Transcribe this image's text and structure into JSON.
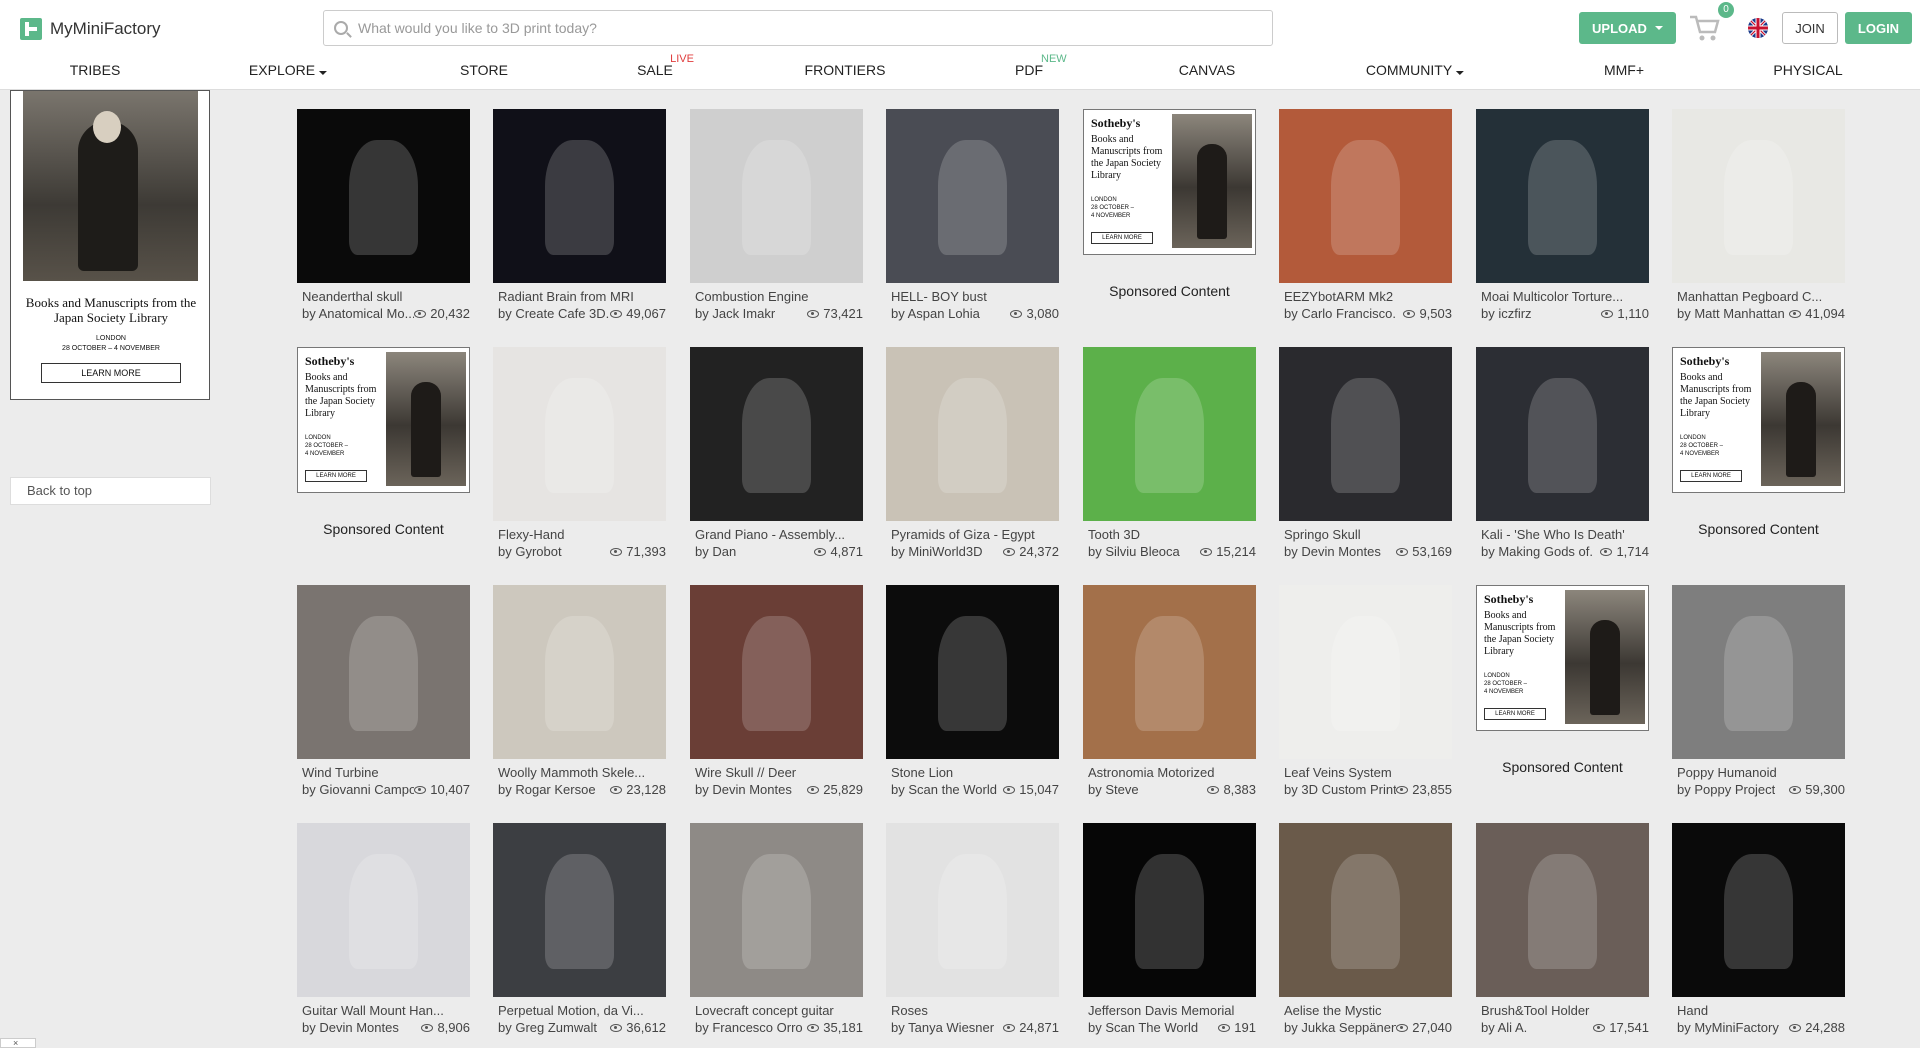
{
  "header": {
    "logo_text": "MyMiniFactory",
    "search_placeholder": "What would you like to 3D print today?",
    "upload_label": "UPLOAD",
    "cart_count": "0",
    "join_label": "JOIN",
    "login_label": "LOGIN"
  },
  "nav": {
    "items": [
      {
        "label": "TRIBES"
      },
      {
        "label": "EXPLORE"
      },
      {
        "label": "STORE"
      },
      {
        "label": "SALE",
        "badge": "LIVE"
      },
      {
        "label": "FRONTIERS"
      },
      {
        "label": "PDF",
        "badge": "NEW"
      },
      {
        "label": "CANVAS"
      },
      {
        "label": "COMMUNITY"
      },
      {
        "label": "MMF+"
      },
      {
        "label": "PHYSICAL"
      }
    ]
  },
  "sidebar": {
    "ad_title": "Books and Manuscripts from the Japan Society Library",
    "ad_sub": "LONDON\n28 OCTOBER – 4 NOVEMBER",
    "ad_button": "LEARN MORE",
    "back_to_top": "Back to top"
  },
  "sponsor": {
    "brand": "Sotheby's",
    "text": "Books and Manuscripts from the Japan Society Library",
    "small": "LONDON\n28 OCTOBER –\n4 NOVEMBER",
    "button": "LEARN MORE",
    "label": "Sponsored Content"
  },
  "rows": [
    [
      {
        "title": "Neanderthal skull",
        "author": "by Anatomical Mo...",
        "views": "20,432",
        "color": "#0a0a0a"
      },
      {
        "title": "Radiant Brain from MRI",
        "author": "by Create Cafe 3D...",
        "views": "49,067",
        "color": "#101018"
      },
      {
        "title": "Combustion Engine",
        "author": "by Jack Imakr",
        "views": "73,421",
        "color": "#cfcfcf"
      },
      {
        "title": "HELL- BOY bust",
        "author": "by Aspan Lohia",
        "views": "3,080",
        "color": "#4a4c54"
      },
      {
        "sponsored": true
      },
      {
        "title": "EEZYbotARM Mk2",
        "author": "by Carlo Francisco...",
        "views": "9,503",
        "color": "#b35a3a"
      },
      {
        "title": "Moai Multicolor Torture...",
        "author": "by iczfirz",
        "views": "1,110",
        "color": "#243038"
      },
      {
        "title": "Manhattan Pegboard C...",
        "author": "by Matt Manhattan",
        "views": "41,094",
        "color": "#e8e8e4"
      }
    ],
    [
      {
        "sponsored": true
      },
      {
        "title": "Flexy-Hand",
        "author": "by Gyrobot",
        "views": "71,393",
        "color": "#e6e4e2"
      },
      {
        "title": "Grand Piano - Assembly...",
        "author": "by Dan",
        "views": "4,871",
        "color": "#222222"
      },
      {
        "title": "Pyramids of Giza - Egypt",
        "author": "by MiniWorld3D",
        "views": "24,372",
        "color": "#c9c2b6"
      },
      {
        "title": "Tooth 3D",
        "author": "by Silviu Bleoca",
        "views": "15,214",
        "color": "#5cb04a"
      },
      {
        "title": "Springo Skull",
        "author": "by Devin Montes",
        "views": "53,169",
        "color": "#2a2a2e"
      },
      {
        "title": "Kali - 'She Who Is Death'",
        "author": "by Making Gods of...",
        "views": "1,714",
        "color": "#2c2e34"
      },
      {
        "sponsored": true
      }
    ],
    [
      {
        "title": "Wind Turbine",
        "author": "by Giovanni Campo...",
        "views": "10,407",
        "color": "#7a7470"
      },
      {
        "title": "Woolly Mammoth Skele...",
        "author": "by Rogar Kersoe",
        "views": "23,128",
        "color": "#cdc8be"
      },
      {
        "title": "Wire Skull // Deer",
        "author": "by Devin Montes",
        "views": "25,829",
        "color": "#6a3e36"
      },
      {
        "title": "Stone Lion",
        "author": "by Scan the World",
        "views": "15,047",
        "color": "#0c0c0c"
      },
      {
        "title": "Astronomia Motorized",
        "author": "by Steve",
        "views": "8,383",
        "color": "#a3704a"
      },
      {
        "title": "Leaf Veins System",
        "author": "by 3D Custom Print",
        "views": "23,855",
        "color": "#eeeeec"
      },
      {
        "sponsored": true
      },
      {
        "title": "Poppy Humanoid",
        "author": "by Poppy Project",
        "views": "59,300",
        "color": "#7e7e7e"
      }
    ],
    [
      {
        "title": "Guitar Wall Mount Han...",
        "author": "by Devin Montes",
        "views": "8,906",
        "color": "#d8d8dc"
      },
      {
        "title": "Perpetual Motion, da Vi...",
        "author": "by Greg Zumwalt",
        "views": "36,612",
        "color": "#3c3e42"
      },
      {
        "title": "Lovecraft concept guitar",
        "author": "by Francesco Orro",
        "views": "35,181",
        "color": "#8e8a86"
      },
      {
        "title": "Roses",
        "author": "by Tanya Wiesner",
        "views": "24,871",
        "color": "#e2e2e2"
      },
      {
        "title": "Jefferson Davis Memorial",
        "author": "by Scan The World",
        "views": "191",
        "color": "#060606"
      },
      {
        "title": "Aelise the Mystic",
        "author": "by Jukka Seppänen",
        "views": "27,040",
        "color": "#6a5a4a"
      },
      {
        "title": "Brush&Tool Holder",
        "author": "by Ali A.",
        "views": "17,541",
        "color": "#6a5e58"
      },
      {
        "title": "Hand",
        "author": "by MyMiniFactory",
        "views": "24,288",
        "color": "#0a0a0a"
      }
    ]
  ]
}
